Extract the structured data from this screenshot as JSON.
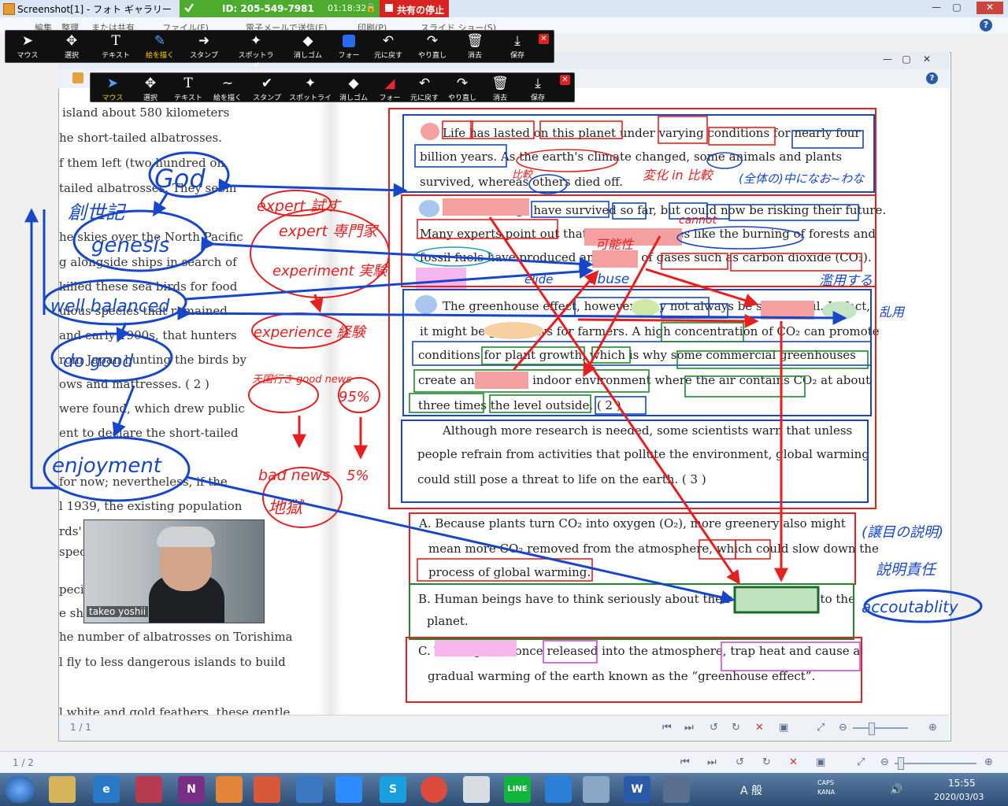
{
  "window": {
    "title": "Screenshot[1] - フォト ギャラリー"
  },
  "share_bar": {
    "meeting_id": "ID: 205-549-7981",
    "timer": "01:18:32",
    "stop_label": "共有の停止"
  },
  "outer_menu": {
    "items": [
      "編集",
      "整理",
      "または共有",
      "ファイル(F)",
      "電子メールで送信(E)",
      "印刷(P)",
      "スライド ショー(S)"
    ]
  },
  "outer_window_buttons": [
    "—",
    "▢",
    "✕"
  ],
  "toolbar_outer": {
    "tools": [
      {
        "icon": "cursor-icon",
        "label": "マウス"
      },
      {
        "icon": "move-icon",
        "label": "選択"
      },
      {
        "icon": "text-icon",
        "label": "テキスト"
      },
      {
        "icon": "pen-icon",
        "label": "絵を描く"
      },
      {
        "icon": "stamp-icon",
        "label": "スタンプ"
      },
      {
        "icon": "spotlight-icon",
        "label": "スポットライ"
      },
      {
        "icon": "eraser-icon",
        "label": "消しゴム"
      },
      {
        "icon": "color-square-icon",
        "label": "フォー"
      },
      {
        "icon": "undo-icon",
        "label": "元に戻す"
      },
      {
        "icon": "redo-icon",
        "label": "やり直し"
      },
      {
        "icon": "trash-icon",
        "label": "消去"
      },
      {
        "icon": "save-icon",
        "label": "保存"
      }
    ],
    "active": "絵を描く"
  },
  "toolbar_inner": {
    "tools": [
      {
        "icon": "cursor-icon",
        "label": "マウス"
      },
      {
        "icon": "move-icon",
        "label": "選択"
      },
      {
        "icon": "text-icon",
        "label": "テキスト"
      },
      {
        "icon": "pen-icon",
        "label": "絵を描く"
      },
      {
        "icon": "stamp-icon",
        "label": "スタンプ"
      },
      {
        "icon": "spotlight-icon",
        "label": "スポットライ"
      },
      {
        "icon": "eraser-icon",
        "label": "消しゴム"
      },
      {
        "icon": "color-icon",
        "label": "フォー"
      },
      {
        "icon": "undo-icon",
        "label": "元に戻す"
      },
      {
        "icon": "redo-icon",
        "label": "やり直し"
      },
      {
        "icon": "trash-icon",
        "label": "消去"
      },
      {
        "icon": "save-icon",
        "label": "保存"
      }
    ],
    "active": "マウス"
  },
  "left_text": [
    "island about 580 kilometers",
    "he short-tailed albatrosses.",
    "f them left (two hundred on",
    "tailed albatrosses. They seem",
    "he skies over the North Pacific",
    "g alongside ships in search of",
    "killed these sea birds for food",
    "ulous species that remained",
    "and early 1900s, that hunters",
    "rom Japan hunting the birds by",
    "ows and mattresses. ( 2 )",
    "were found, which drew public",
    "ent to declare the short-tailed",
    "for now; nevertheless, if the",
    "l 1939, the existing population",
    "rds'",
    "spec",
    "pecie",
    "e sho",
    "he number of albatrosses on Torishima",
    "l fly to less dangerous islands to build",
    "l white and gold feathers, these gentle"
  ],
  "passage": {
    "p1": [
      "Life has lasted on this planet under varying conditions for nearly four",
      "billion years. As the earth's climate changed, some animals and plants",
      "survived, whereas others died off."
    ],
    "p2": [
      "Human beings have survived so far, but could now be risking their future.",
      "Many experts point out that human activities like the burning of forests and",
      "fossil fuels have produced an excess of gases such as carbon dioxide (CO₂).",
      "( 1 )"
    ],
    "p3": [
      "The greenhouse effect, however, may not always be so harmful. In fact,",
      "it might be good news for farmers. A high concentration of CO₂ can promote",
      "conditions for plant growth, which is why some commercial greenhouses",
      "create an artificial indoor environment where the air contains CO₂ at about",
      "three times the level outside. ( 2 )"
    ],
    "p4": [
      "Although more research is needed, some scientists warn that unless",
      "people refrain from activities that pollute the environment, global warming",
      "could still pose a threat to life on the earth. ( 3 )"
    ]
  },
  "choices": {
    "a": [
      "A. Because plants turn CO₂ into oxygen (O₂), more greenery also might",
      "mean more CO₂ removed from the atmosphere, which could slow down the",
      "process of global warming."
    ],
    "b": [
      "B. Human beings have to think seriously about their responsibility to the",
      "planet."
    ],
    "c": [
      "C. These gases, once released into the atmosphere, trap heat and cause a",
      "gradual warming of the earth known as the “greenhouse effect”."
    ]
  },
  "annotations_blue": [
    "God",
    "創世記",
    "genesis",
    "well balanced",
    "do good",
    "enjoyment",
    "accoutablity",
    "(全体の)中になお~わな",
    "乱用",
    "(譲目の説明)",
    "説明責任"
  ],
  "annotations_red": [
    "expert 試す",
    "expert 専門家",
    "experiment 実験",
    "experience 経験",
    "天国行き good news",
    "95%",
    "bad news",
    "5%",
    "地獄",
    "比較",
    "変化 in 比較",
    "cannot",
    "可能性",
    "abuse",
    "濫用する",
    "elide"
  ],
  "video": {
    "name": "takeo yoshii"
  },
  "doc_status": {
    "page": "1 / 1"
  },
  "app_status": {
    "page": "1 / 2"
  },
  "taskbar": {
    "time": "15:55",
    "date": "2020/03/03",
    "ime": "A 般",
    "caps": "CAPS",
    "kana": "KANA"
  },
  "colors": {
    "share_green": "#4dac2e",
    "stop_red": "#d92323",
    "ink_blue": "#1747c8",
    "ink_red": "#e62020",
    "highlight_red": "#f4a0a0",
    "highlight_green": "#bfe3bf"
  }
}
